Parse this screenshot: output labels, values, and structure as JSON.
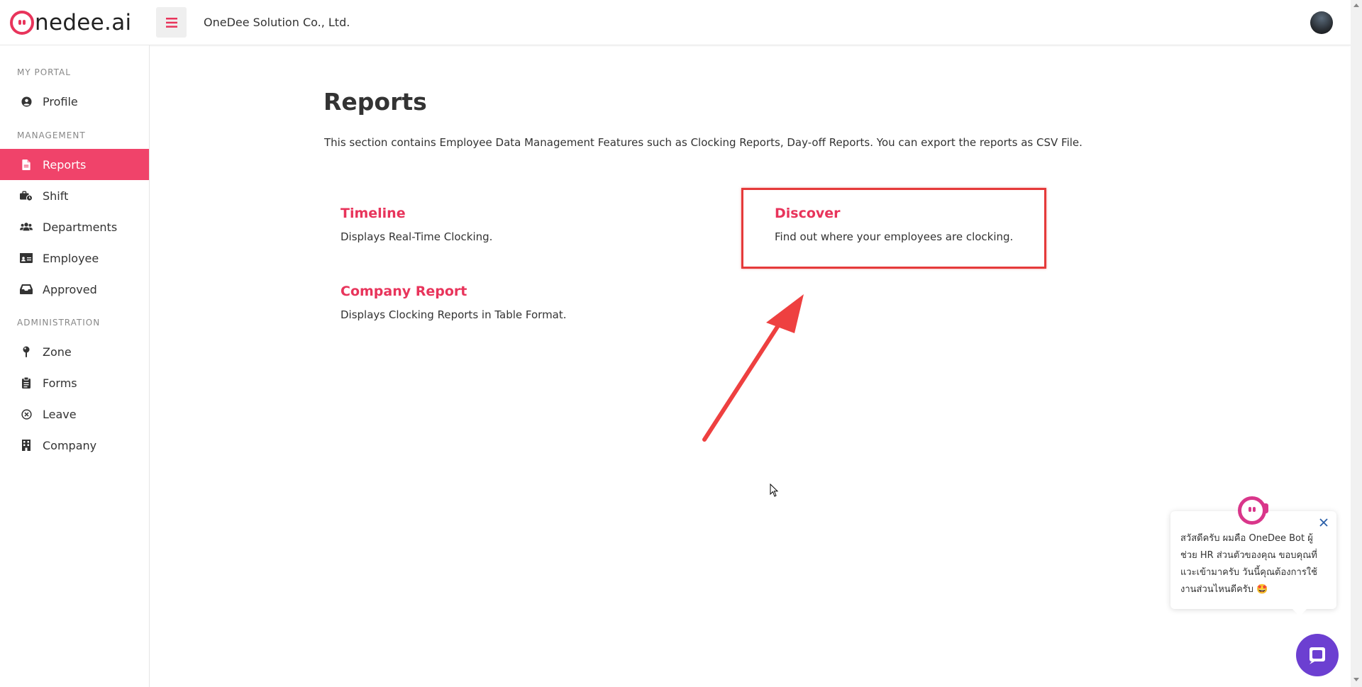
{
  "brand": {
    "logo_text": "nedee.ai",
    "accent_color": "#e8345b"
  },
  "header": {
    "company": "OneDee Solution Co., Ltd.",
    "menu_icon": "hamburger-icon",
    "avatar_icon": "user-avatar"
  },
  "sidebar": {
    "sections": [
      "MY PORTAL",
      "MANAGEMENT",
      "ADMINISTRATION"
    ],
    "items": [
      {
        "label": "Profile",
        "icon": "user-circle-icon"
      },
      {
        "label": "Reports",
        "icon": "file-icon",
        "active": true
      },
      {
        "label": "Shift",
        "icon": "briefcase-clock-icon"
      },
      {
        "label": "Departments",
        "icon": "users-icon"
      },
      {
        "label": "Employee",
        "icon": "id-card-icon"
      },
      {
        "label": "Approved",
        "icon": "inbox-icon"
      },
      {
        "label": "Zone",
        "icon": "map-pin-icon"
      },
      {
        "label": "Forms",
        "icon": "clipboard-icon"
      },
      {
        "label": "Leave",
        "icon": "circle-x-icon"
      },
      {
        "label": "Company",
        "icon": "building-icon"
      }
    ]
  },
  "main": {
    "title": "Reports",
    "description": "This section contains Employee Data Management Features such as Clocking Reports, Day-off Reports. You can export the reports as CSV File.",
    "cards": [
      {
        "title": "Timeline",
        "description": "Displays Real-Time Clocking."
      },
      {
        "title": "Discover",
        "description": "Find out where your employees are clocking."
      },
      {
        "title": "Company Report",
        "description": "Displays Clocking Reports in Table Format."
      }
    ]
  },
  "chat": {
    "message": "สวัสดีครับ ผมคือ OneDee Bot ผู้ช่วย HR ส่วนตัวของคุณ ขอบคุณที่แวะเข้ามาครับ วันนี้คุณต้องการใช้งานส่วนไหนดีครับ 🤩",
    "close_icon": "close-icon",
    "launcher_icon": "chat-icon"
  }
}
